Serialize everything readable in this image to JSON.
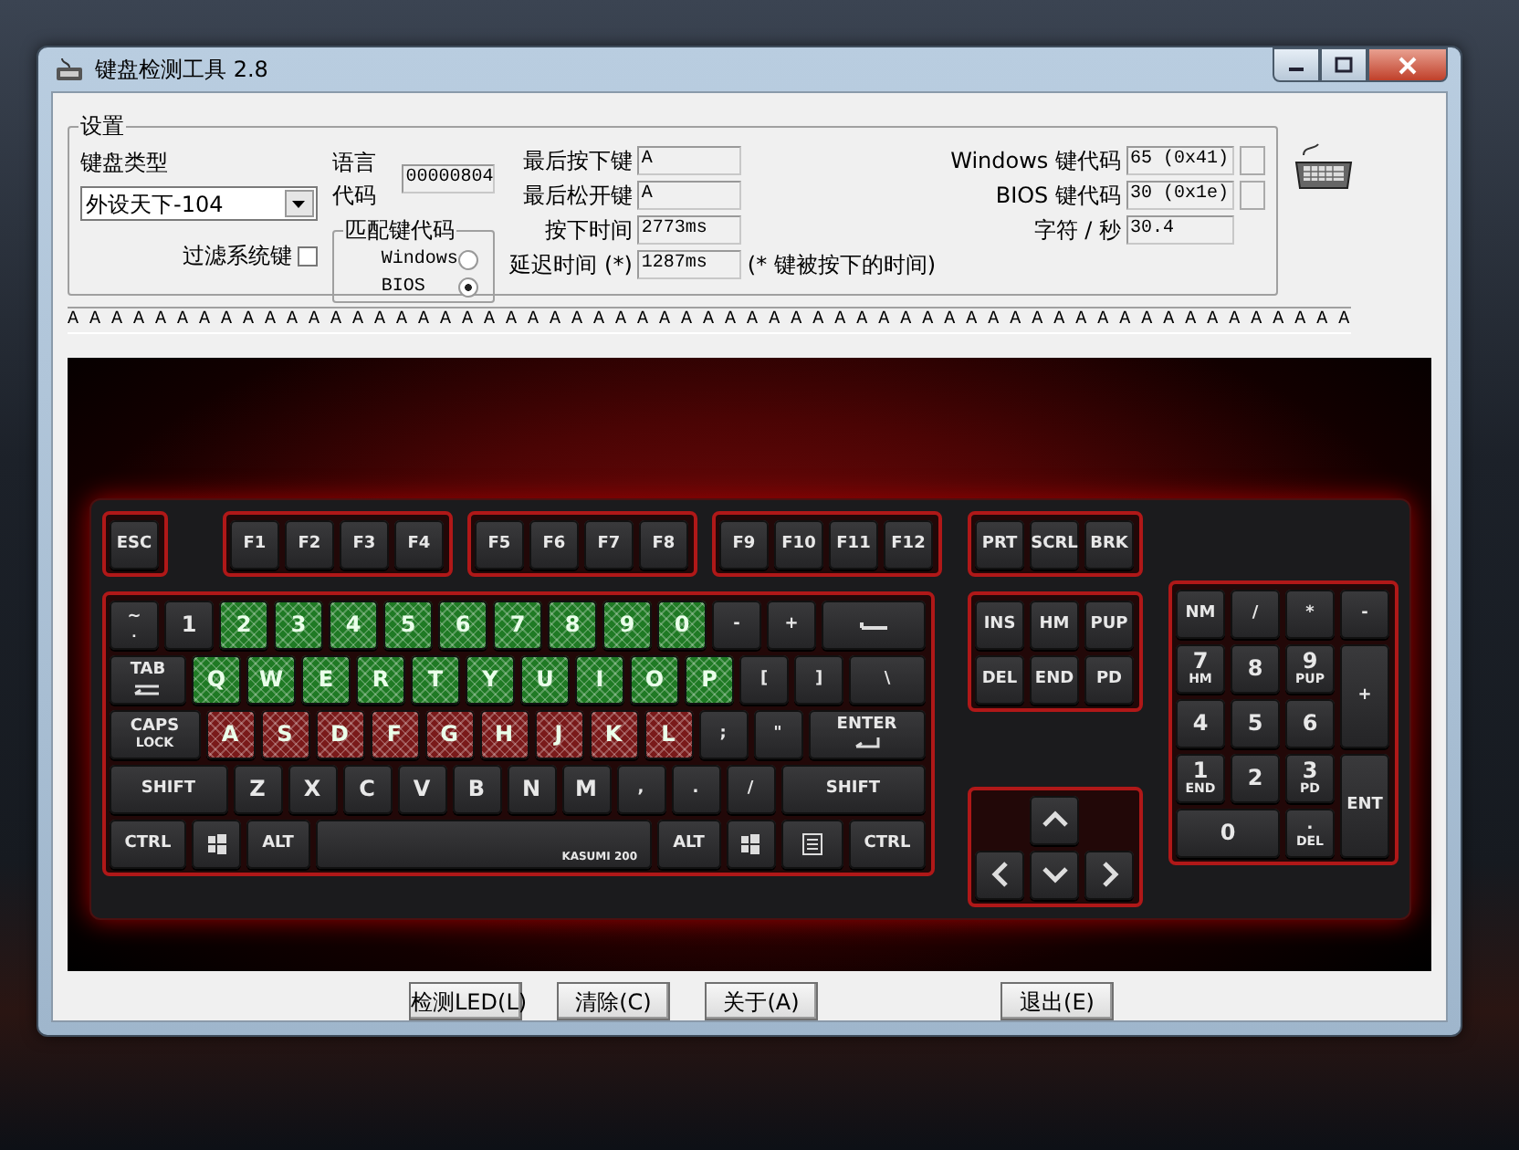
{
  "window": {
    "title": "键盘检测工具 2.8"
  },
  "settings": {
    "group_title": "设置",
    "keyboard_type_label": "键盘类型",
    "keyboard_type_value": "外设天下-104",
    "filter_label": "过滤系统键",
    "filter_checked": false
  },
  "language_code": {
    "label": "语言代码",
    "value": "00000804"
  },
  "match_code": {
    "title": "匹配键代码",
    "options": [
      {
        "label": "Windows",
        "selected": false
      },
      {
        "label": "BIOS",
        "selected": true
      }
    ]
  },
  "key_info": [
    {
      "label": "最后按下键",
      "value": "A"
    },
    {
      "label": "最后松开键",
      "value": "A"
    },
    {
      "label": "按下时间",
      "value": "2773ms"
    },
    {
      "label": "延迟时间 (*)",
      "value": "1287ms"
    }
  ],
  "code_info": [
    {
      "label": "Windows 键代码",
      "value": "65 (0x41)",
      "has_indicator": true
    },
    {
      "label": "BIOS 键代码",
      "value": "30 (0x1e)",
      "has_indicator": true
    },
    {
      "label": "字符 / 秒",
      "value": "30.4"
    }
  ],
  "delay_note": "(* 键被按下的时间)",
  "key_log": "A A A A A A A A A A A A A A A A A A A A A A A A A A A A A A A A A A A A A A A A A A A A A A A A A A A A A A A A A A A",
  "keyboard": {
    "function_groups": [
      [
        {
          "kind": "key",
          "label": "ESC"
        }
      ],
      [
        {
          "kind": "key",
          "label": "F1"
        },
        {
          "kind": "key",
          "label": "F2"
        },
        {
          "kind": "key",
          "label": "F3"
        },
        {
          "kind": "key",
          "label": "F4"
        }
      ],
      [
        {
          "kind": "key",
          "label": "F5"
        },
        {
          "kind": "key",
          "label": "F6"
        },
        {
          "kind": "key",
          "label": "F7"
        },
        {
          "kind": "key",
          "label": "F8"
        }
      ],
      [
        {
          "kind": "key",
          "label": "F9"
        },
        {
          "kind": "key",
          "label": "F10"
        },
        {
          "kind": "key",
          "label": "F11"
        },
        {
          "kind": "key",
          "label": "F12"
        }
      ]
    ],
    "system_keys": [
      {
        "kind": "key",
        "label": "PRT"
      },
      {
        "kind": "key",
        "label": "SCRL"
      },
      {
        "kind": "key",
        "label": "BRK"
      }
    ],
    "main_rows": [
      [
        {
          "kind": "key",
          "label": "~",
          "sub": "."
        },
        {
          "kind": "key",
          "label": "1"
        },
        {
          "kind": "key",
          "label": "2",
          "color": "#1f7a24"
        },
        {
          "kind": "key",
          "label": "3",
          "color": "#1f7a24"
        },
        {
          "kind": "key",
          "label": "4",
          "color": "#1f7a24"
        },
        {
          "kind": "key",
          "label": "5",
          "color": "#1f7a24"
        },
        {
          "kind": "key",
          "label": "6",
          "color": "#1f7a24"
        },
        {
          "kind": "key",
          "label": "7",
          "color": "#1f7a24"
        },
        {
          "kind": "key",
          "label": "8",
          "color": "#1f7a24"
        },
        {
          "kind": "key",
          "label": "9",
          "color": "#1f7a24"
        },
        {
          "kind": "key",
          "label": "0",
          "color": "#1f7a24"
        },
        {
          "kind": "key",
          "label": "-"
        },
        {
          "kind": "key",
          "label": "+"
        },
        {
          "kind": "backspace"
        }
      ],
      [
        {
          "kind": "tab",
          "label": "TAB"
        },
        {
          "kind": "key",
          "label": "Q",
          "color": "#1f7a24"
        },
        {
          "kind": "key",
          "label": "W",
          "color": "#1f7a24"
        },
        {
          "kind": "key",
          "label": "E",
          "color": "#1f7a24"
        },
        {
          "kind": "key",
          "label": "R",
          "color": "#1f7a24"
        },
        {
          "kind": "key",
          "label": "T",
          "color": "#1f7a24"
        },
        {
          "kind": "key",
          "label": "Y",
          "color": "#1f7a24"
        },
        {
          "kind": "key",
          "label": "U",
          "color": "#1f7a24"
        },
        {
          "kind": "key",
          "label": "I",
          "color": "#1f7a24"
        },
        {
          "kind": "key",
          "label": "O",
          "color": "#1f7a24"
        },
        {
          "kind": "key",
          "label": "P",
          "color": "#1f7a24"
        },
        {
          "kind": "key",
          "label": "["
        },
        {
          "kind": "key",
          "label": "]"
        },
        {
          "kind": "backslash",
          "label": "\\"
        }
      ],
      [
        {
          "kind": "caps",
          "label": "CAPS",
          "sub": "LOCK"
        },
        {
          "kind": "key",
          "label": "A",
          "color": "#7a1a1a"
        },
        {
          "kind": "key",
          "label": "S",
          "color": "#7a1a1a"
        },
        {
          "kind": "key",
          "label": "D",
          "color": "#7a1a1a"
        },
        {
          "kind": "key",
          "label": "F",
          "color": "#7a1a1a"
        },
        {
          "kind": "key",
          "label": "G",
          "color": "#7a1a1a"
        },
        {
          "kind": "key",
          "label": "H",
          "color": "#7a1a1a"
        },
        {
          "kind": "key",
          "label": "J",
          "color": "#7a1a1a"
        },
        {
          "kind": "key",
          "label": "K",
          "color": "#7a1a1a"
        },
        {
          "kind": "key",
          "label": "L",
          "color": "#7a1a1a"
        },
        {
          "kind": "key",
          "label": ";"
        },
        {
          "kind": "key",
          "label": "\""
        },
        {
          "kind": "enter",
          "label": "ENTER"
        }
      ],
      [
        {
          "kind": "lshift",
          "label": "SHIFT"
        },
        {
          "kind": "key",
          "label": "Z"
        },
        {
          "kind": "key",
          "label": "X"
        },
        {
          "kind": "key",
          "label": "C"
        },
        {
          "kind": "key",
          "label": "V"
        },
        {
          "kind": "key",
          "label": "B"
        },
        {
          "kind": "key",
          "label": "N"
        },
        {
          "kind": "key",
          "label": "M"
        },
        {
          "kind": "key",
          "label": ","
        },
        {
          "kind": "key",
          "label": "."
        },
        {
          "kind": "key",
          "label": "/"
        },
        {
          "kind": "rshift",
          "label": "SHIFT"
        }
      ],
      [
        {
          "kind": "ctrl",
          "label": "CTRL"
        },
        {
          "kind": "win"
        },
        {
          "kind": "alt",
          "label": "ALT"
        },
        {
          "kind": "space",
          "label": "KASUMI 200"
        },
        {
          "kind": "alt",
          "label": "ALT"
        },
        {
          "kind": "win"
        },
        {
          "kind": "menu"
        },
        {
          "kind": "ctrl",
          "label": "CTRL"
        }
      ]
    ],
    "nav_keys": [
      {
        "kind": "key",
        "label": "INS"
      },
      {
        "kind": "key",
        "label": "HM"
      },
      {
        "kind": "key",
        "label": "PUP"
      },
      {
        "kind": "key",
        "label": "DEL"
      },
      {
        "kind": "key",
        "label": "END"
      },
      {
        "kind": "key",
        "label": "PD"
      }
    ],
    "arrow_keys": [
      {
        "kind": "up"
      },
      {
        "kind": "left"
      },
      {
        "kind": "down"
      },
      {
        "kind": "right"
      }
    ],
    "numpad": [
      {
        "kind": "key",
        "label": "NM"
      },
      {
        "kind": "key",
        "label": "/"
      },
      {
        "kind": "key",
        "label": "*"
      },
      {
        "kind": "key",
        "label": "-"
      },
      {
        "kind": "key",
        "label": "7",
        "sub": "HM"
      },
      {
        "kind": "key",
        "label": "8"
      },
      {
        "kind": "key",
        "label": "9",
        "sub": "PUP"
      },
      {
        "kind": "tall",
        "label": "+"
      },
      {
        "kind": "key",
        "label": "4"
      },
      {
        "kind": "key",
        "label": "5"
      },
      {
        "kind": "key",
        "label": "6"
      },
      {
        "kind": "key",
        "label": "1",
        "sub": "END"
      },
      {
        "kind": "key",
        "label": "2"
      },
      {
        "kind": "key",
        "label": "3",
        "sub": "PD"
      },
      {
        "kind": "tall",
        "label": "ENT"
      },
      {
        "kind": "wide",
        "label": "0"
      },
      {
        "kind": "key",
        "label": ".",
        "sub": "DEL"
      }
    ]
  },
  "buttons": [
    "检测LED(L)",
    "清除(C)",
    "关于(A)",
    "退出(E)"
  ]
}
